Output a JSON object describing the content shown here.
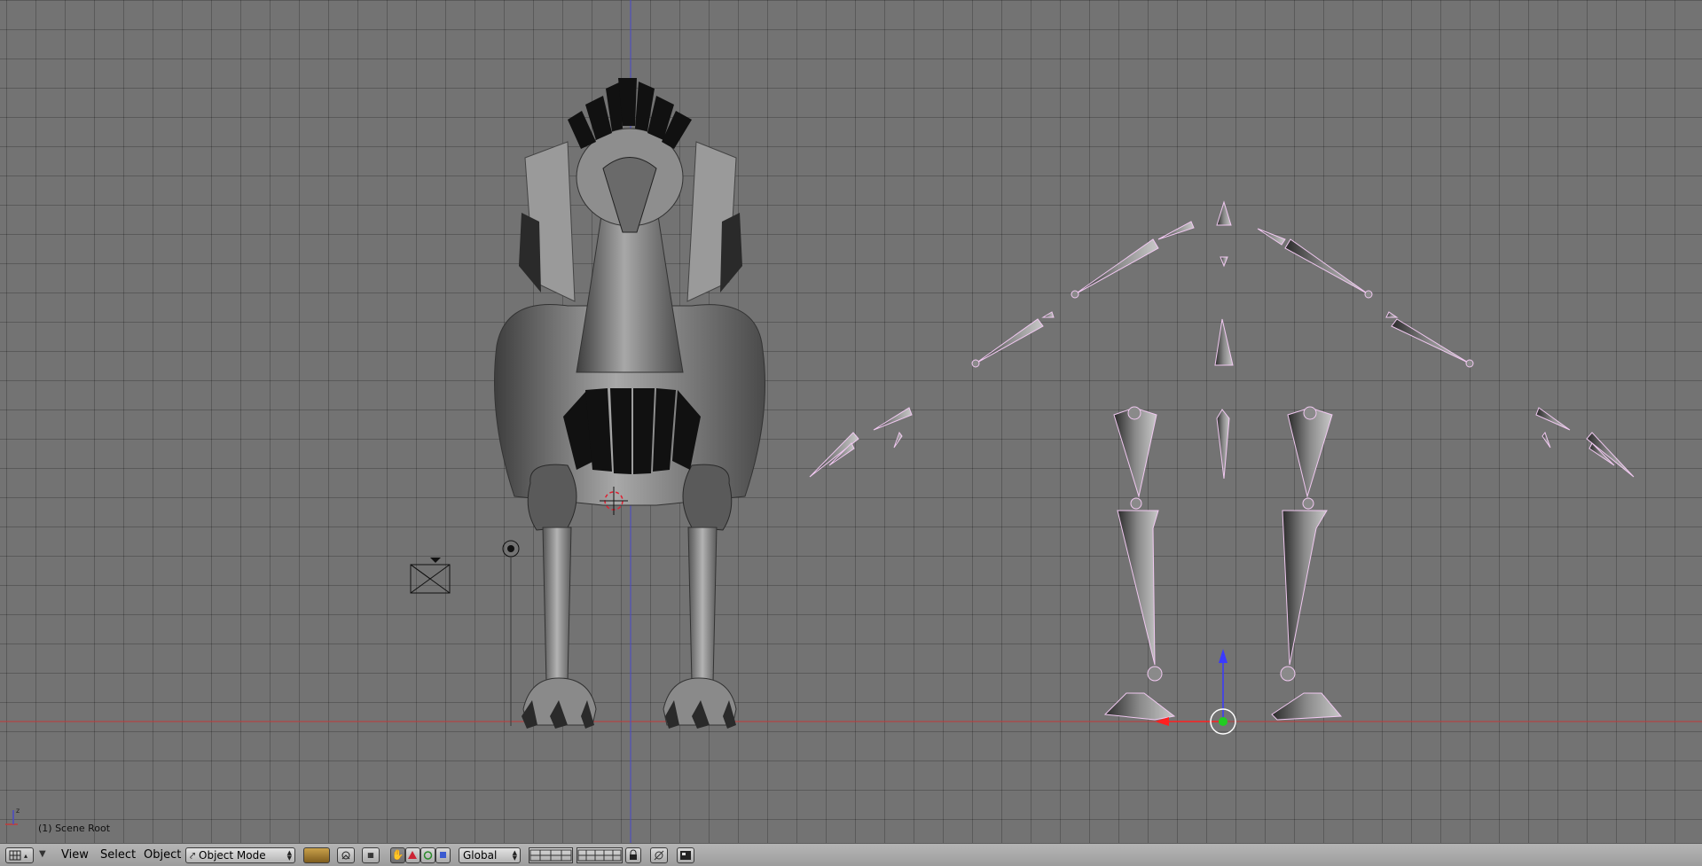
{
  "scene_info": "(1) Scene Root",
  "axis_gizmo_label": "z",
  "header": {
    "menus": [
      "View",
      "Select",
      "Object"
    ],
    "mode": "Object Mode",
    "orientation": "Global"
  },
  "colors": {
    "viewport_bg": "#737373",
    "x_axis": "#c23a3a",
    "z_axis": "#4a4ac8",
    "bone_outline": "#f0c8f0"
  },
  "icons": [
    "editor-type-icon",
    "shading-solid-icon",
    "pivot-icon",
    "hand-manipulator-icon",
    "translate-icon",
    "rotate-icon",
    "scale-icon",
    "layer-grid-icon",
    "lock-icon",
    "render-icon"
  ]
}
